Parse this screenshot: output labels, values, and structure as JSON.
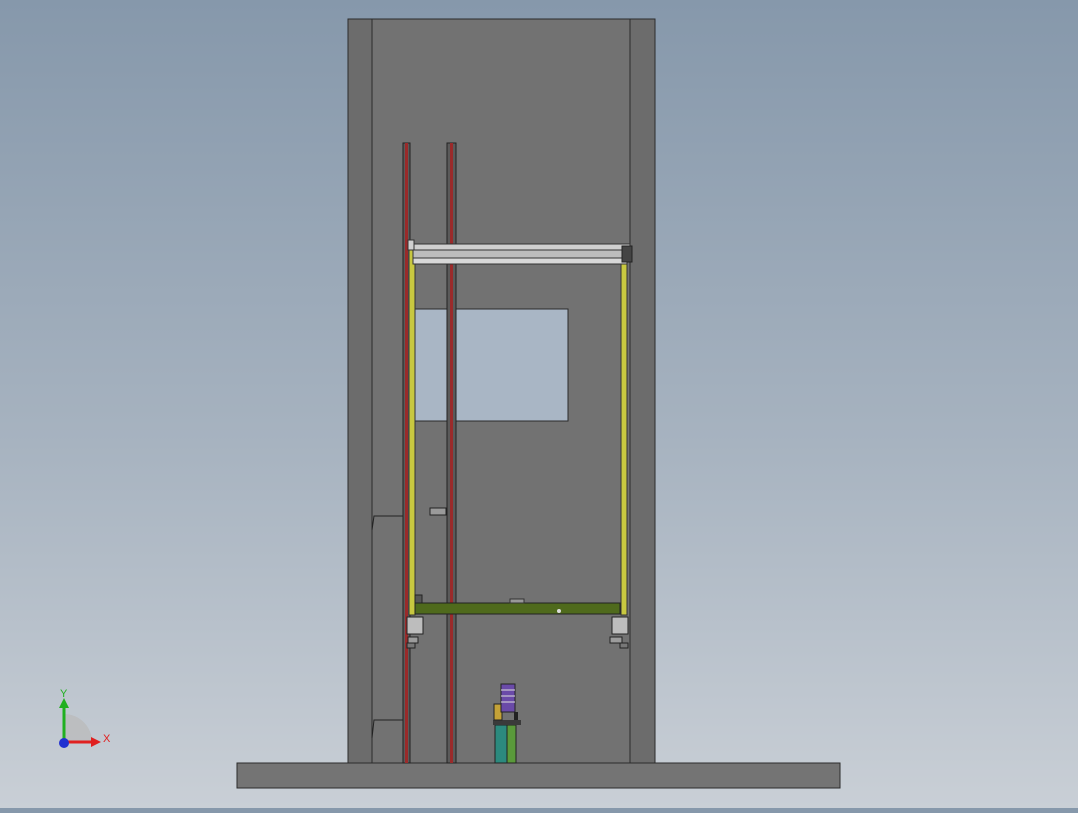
{
  "viewport": {
    "background_top": "#8698ab",
    "background_bottom": "#c9cfd6"
  },
  "model": {
    "shaft_color": "#727272",
    "edge_color": "#2b2b2b",
    "rail_color": "#9a2a2a",
    "car_frame_color": "#c8c840",
    "platform_color": "#4f6a1c",
    "opening_color": "#a9b6c5",
    "buffer_spring_color": "#6a4aa8",
    "buffer_base_color": "#2c8a7e"
  },
  "triad": {
    "x_label": "X",
    "y_label": "Y",
    "x_color": "#e02020",
    "y_color": "#20b020",
    "z_color": "#2030d0"
  }
}
